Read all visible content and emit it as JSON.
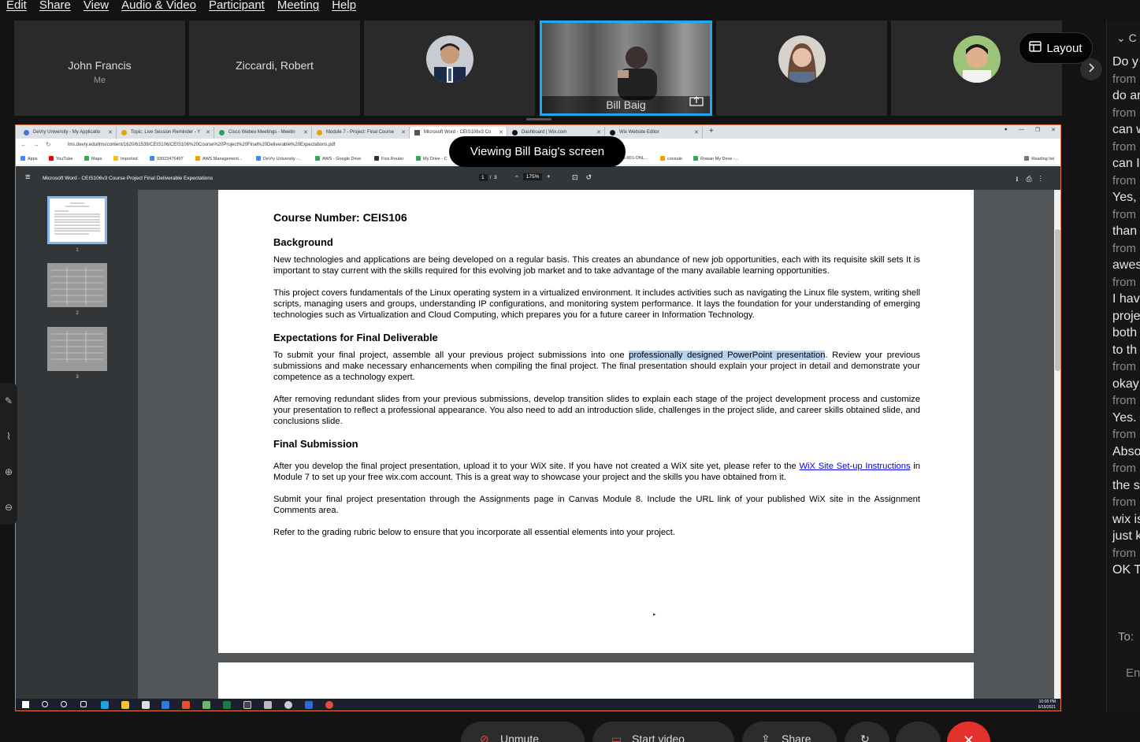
{
  "menu": [
    "Edit",
    "Share",
    "View",
    "Audio & Video",
    "Participant",
    "Meeting",
    "Help"
  ],
  "participants": [
    {
      "name": "John Francis",
      "sub": "Me"
    },
    {
      "name": "Ziccardi, Robert"
    },
    {
      "name": ""
    },
    {
      "name": "Bill Baig"
    },
    {
      "name": ""
    },
    {
      "name": ""
    }
  ],
  "layout_label": "Layout",
  "banner": "Viewing Bill Baig's screen",
  "browser": {
    "tabs": [
      "DeVry University - My Applicatio",
      "Topic: Live Session Reminder - Y",
      "Cisco Webex Meetings - Meetin",
      "Module 7 - Project: Final Course",
      "Microsoft Word - CEIS106v3 Co",
      "Dashboard | Wix.com",
      "Wix Website Editor"
    ],
    "url": "lms.devry.edu/lms/content/1620/61539/CEIS106/CEIS106%20Course%20Project%20Final%20Deliverable%20Expectations.pdf",
    "bookmarks": [
      "Apps",
      "YouTube",
      "Maps",
      "Imported",
      "93023475497",
      "AWS Management...",
      "DeVry University -...",
      "AWS - Google Drive",
      "Fios Router",
      "My Drive - C",
      "S-001-ONL...",
      "console",
      "Rowan My Drive -...",
      "Reading list"
    ]
  },
  "pdf": {
    "title": "Microsoft Word - CEIS106v3 Course Project Final Deliverable Expectations",
    "page": "1",
    "pages": "/ 3",
    "zoom": "175%",
    "thumb_labels": [
      "1",
      "2",
      "3"
    ]
  },
  "doc": {
    "course": "Course Number: CEIS106",
    "h_background": "Background",
    "p1": "New technologies and applications are being developed on a regular basis. This creates an abundance of new job opportunities, each with its requisite skill sets It is important to stay current with the skills required for this evolving job market and to take advantage of the many available learning opportunities.",
    "p2": "This project covers fundamentals of the Linux operating system in a virtualized environment. It includes activities such as navigating the Linux file system, writing shell scripts, managing users and groups, understanding IP configurations, and monitoring system performance. It lays the foundation for your understanding of emerging technologies such as Virtualization and Cloud Computing, which prepares you for a future career in Information Technology.",
    "h_expect": "Expectations for Final Deliverable",
    "p3a": "To submit your final project, assemble all your previous project submissions into one ",
    "p3hl": "professionally designed PowerPoint presentation",
    "p3b": ". Review your previous submissions and make necessary enhancements when compiling the final project. The final presentation should explain your project in detail and demonstrate your competence as a technology expert.",
    "p4": "After removing redundant slides from your previous submissions, develop transition slides to explain each stage of the project development process and customize your presentation to reflect a professional appearance. You also need to add an introduction slide, challenges in the project slide, and career skills obtained slide, and conclusions slide.",
    "h_final": "Final Submission",
    "p5a": "After you develop the final project presentation, upload it to your WiX site. If you have not created a WiX site yet, please refer to the ",
    "p5link": "WiX Site Set-up Instructions",
    "p5b": " in Module 7 to set up your free wix.com account. This is a great way to showcase your project and the skills you have obtained from it.",
    "p6": "Submit your final project presentation through the Assignments page in Canvas Module 8. Include the URL link of your published WiX site in the Assignment Comments area.",
    "p7": "Refer to the grading rubric below to ensure that you incorporate all essential elements into your project."
  },
  "taskbar_clock": {
    "time": "10:08 PM",
    "date": "6/15/2021"
  },
  "chat": {
    "header": "C",
    "lines": [
      {
        "t": "Do y",
        "k": "msg"
      },
      {
        "t": "from",
        "k": "from"
      },
      {
        "t": "do ar",
        "k": "msg"
      },
      {
        "t": "from",
        "k": "from"
      },
      {
        "t": "can w",
        "k": "msg"
      },
      {
        "t": "from",
        "k": "from"
      },
      {
        "t": "can I",
        "k": "msg"
      },
      {
        "t": "from",
        "k": "from"
      },
      {
        "t": "Yes, i",
        "k": "msg"
      },
      {
        "t": "from",
        "k": "from"
      },
      {
        "t": "than",
        "k": "msg"
      },
      {
        "t": "from",
        "k": "from"
      },
      {
        "t": "awes",
        "k": "msg"
      },
      {
        "t": "from",
        "k": "from"
      },
      {
        "t": "I hav",
        "k": "msg"
      },
      {
        "t": "proje",
        "k": "msg"
      },
      {
        "t": "both",
        "k": "msg"
      },
      {
        "t": "to th",
        "k": "msg"
      },
      {
        "t": "from",
        "k": "from"
      },
      {
        "t": "okay",
        "k": "msg"
      },
      {
        "t": "from",
        "k": "from"
      },
      {
        "t": "Yes. t",
        "k": "msg"
      },
      {
        "t": "from",
        "k": "from"
      },
      {
        "t": "Abso",
        "k": "msg"
      },
      {
        "t": "from",
        "k": "from"
      },
      {
        "t": "the s",
        "k": "msg"
      },
      {
        "t": "from",
        "k": "from"
      },
      {
        "t": "wix is",
        "k": "msg"
      },
      {
        "t": "just k",
        "k": "msg"
      },
      {
        "t": "from",
        "k": "from"
      },
      {
        "t": "OK T",
        "k": "msg"
      }
    ],
    "to_label": "To:",
    "input_placeholder": "En"
  },
  "controls": [
    "Unmute",
    "Start video",
    "Share"
  ]
}
